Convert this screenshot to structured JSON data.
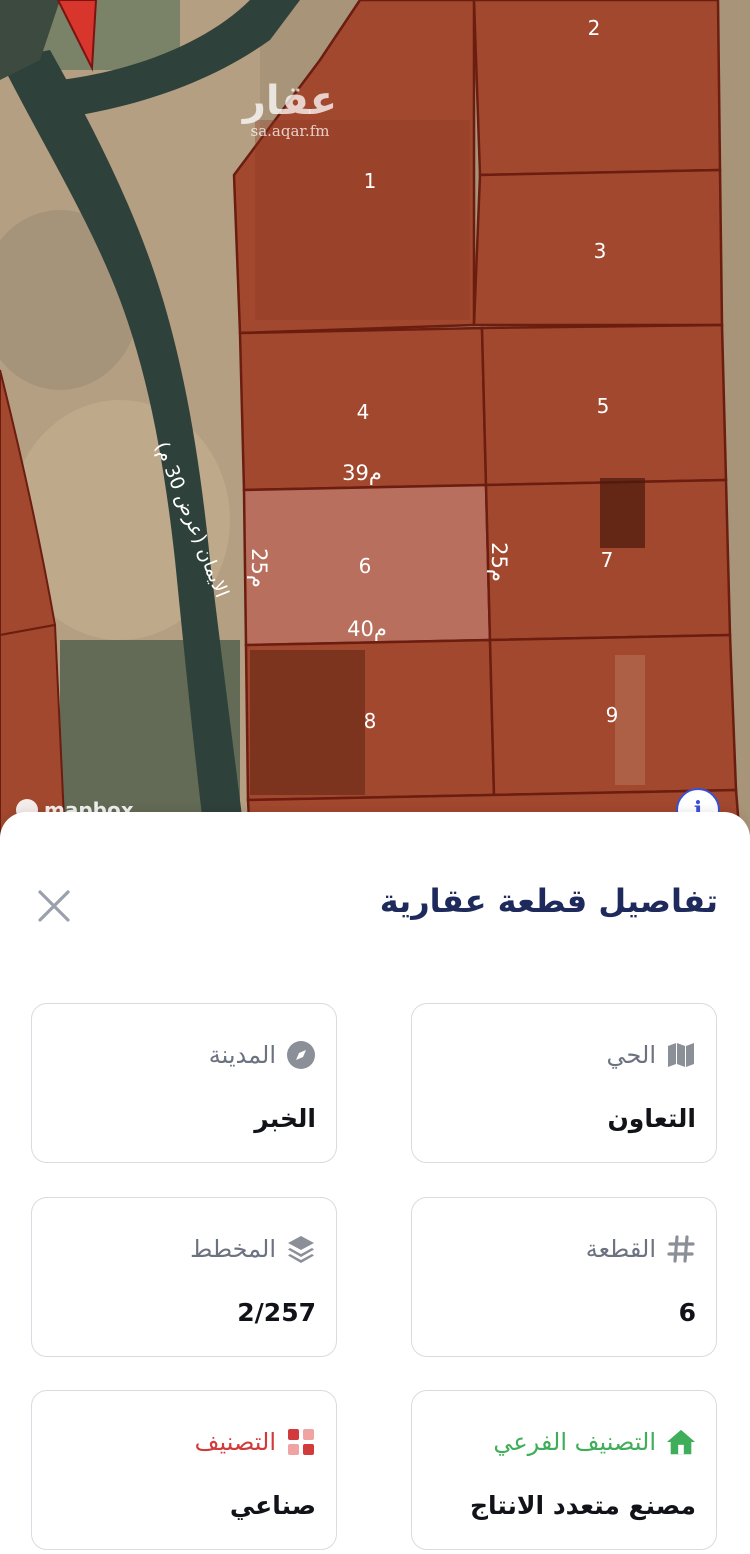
{
  "map": {
    "watermark_logo": "عقار",
    "watermark_url": "sa.aqar.fm",
    "street_label": "الايمان (عرض 30 م)",
    "plot_numbers": [
      "1",
      "2",
      "3",
      "4",
      "5",
      "6",
      "7",
      "8",
      "9"
    ],
    "dimension_labels": {
      "top": "39م",
      "bottom": "40م",
      "left": "25م",
      "right": "25م"
    },
    "attribution": "mapbox",
    "info_icon": "i",
    "colors": {
      "plot_fill": "#a2482e",
      "plot_border": "#6b1d10",
      "selected_fill": "#b86f5e",
      "road": "#2d3f3a"
    }
  },
  "sheet": {
    "title": "تفاصيل قطعة عقارية",
    "close_icon": "close-icon",
    "cards": {
      "district": {
        "label": "الحي",
        "value": "التعاون",
        "icon": "map-icon"
      },
      "city": {
        "label": "المدينة",
        "value": "الخبر",
        "icon": "compass-icon"
      },
      "plot": {
        "label": "القطعة",
        "value": "6",
        "icon": "hash-icon"
      },
      "plan": {
        "label": "المخطط",
        "value": "2/257",
        "icon": "layers-icon"
      },
      "subclass": {
        "label": "التصنيف الفرعي",
        "value": "مصنع متعدد الانتاج",
        "icon": "home-icon",
        "label_color": "#3fae5a"
      },
      "classification": {
        "label": "التصنيف",
        "value": "صناعي",
        "icon": "grid-icon",
        "label_color": "#d23b3b"
      }
    }
  }
}
